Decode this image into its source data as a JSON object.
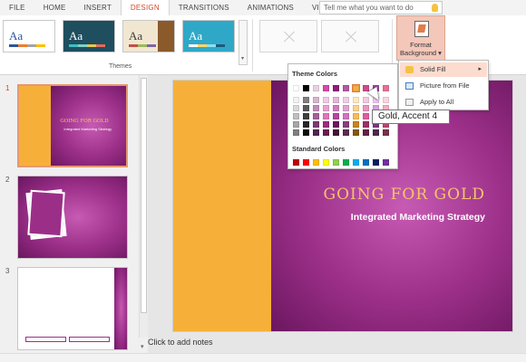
{
  "ribbon_tabs": [
    "FILE",
    "HOME",
    "INSERT",
    "DESIGN",
    "TRANSITIONS",
    "ANIMATIONS",
    "VIEW"
  ],
  "tell_me": {
    "placeholder": "Tell me what you want to do"
  },
  "themes": {
    "label": "Themes",
    "thumb_text": "Aa",
    "items": [
      {
        "bg": "#ffffff",
        "text": "#2b579a"
      },
      {
        "bg": "#1f4e5f",
        "text": "#ffffff"
      },
      {
        "bg": "#f1e7d0",
        "text": "#3d3d3d"
      },
      {
        "bg": "#2fa8c8",
        "text": "#ffffff"
      }
    ]
  },
  "format_background": {
    "line1": "Format",
    "line2": "Background ▾"
  },
  "color_picker": {
    "theme_colors_label": "Theme Colors",
    "standard_colors_label": "Standard Colors",
    "theme_columns": [
      [
        "#ffffff",
        "#f2f2f2",
        "#d9d9d9",
        "#bfbfbf",
        "#a6a6a6",
        "#7f7f7f"
      ],
      [
        "#000000",
        "#7f7f7f",
        "#595959",
        "#3f3f3f",
        "#262626",
        "#0c0c0c"
      ],
      [
        "#e7d2e3",
        "#d6b5d0",
        "#c18db8",
        "#a2619a",
        "#7b3a73",
        "#52254c"
      ],
      [
        "#d54aa6",
        "#f3c9e6",
        "#e8a0d1",
        "#dd76bc",
        "#a02a7c",
        "#6b1c52"
      ],
      [
        "#8d1f7a",
        "#e6b4dc",
        "#cd7dbd",
        "#b4459f",
        "#6b175b",
        "#470f3c"
      ],
      [
        "#b25aa2",
        "#efcfe8",
        "#dfa2d1",
        "#cf75bb",
        "#86407a",
        "#5a2b51"
      ],
      [
        "#f6b03a",
        "#fde9c6",
        "#fbd28e",
        "#f8bc56",
        "#c7851a",
        "#845811"
      ],
      [
        "#ce4b8d",
        "#f5c9df",
        "#ea94be",
        "#df5e9e",
        "#9d2e66",
        "#691e44"
      ],
      [
        "#a14fa8",
        "#ecc8ef",
        "#d89de0",
        "#c672d0",
        "#773a7e",
        "#4f2654"
      ],
      [
        "#e3729a",
        "#fad5e2",
        "#f4abc5",
        "#ef81a8",
        "#b84670",
        "#7a2f4a"
      ]
    ],
    "standard": [
      "#c00000",
      "#ff0000",
      "#ffc000",
      "#ffff00",
      "#92d050",
      "#00b050",
      "#00b0f0",
      "#0070c0",
      "#002060",
      "#7030a0"
    ]
  },
  "bg_menu": {
    "items": [
      {
        "label": "Solid Fill",
        "icon": "paint-bucket-icon"
      },
      {
        "label": "Picture from File",
        "icon": "picture-icon"
      },
      {
        "label": "Apply to All",
        "icon": "apply-all-icon"
      }
    ],
    "submenu_arrow": "▸"
  },
  "tooltip": "Gold, Accent 4",
  "slides": [
    {
      "number": "1",
      "title": "GOING FOR GOLD",
      "subtitle": "Integrated Marketing Strategy"
    },
    {
      "number": "2"
    },
    {
      "number": "3"
    }
  ],
  "main_slide": {
    "title": "GOING FOR GOLD",
    "subtitle": "Integrated Marketing Strategy"
  },
  "notes_placeholder": "Click to add notes",
  "colors": {
    "accent_tab": "#d24726",
    "gold": "#f6b03a",
    "purple": "#9b2f88"
  }
}
